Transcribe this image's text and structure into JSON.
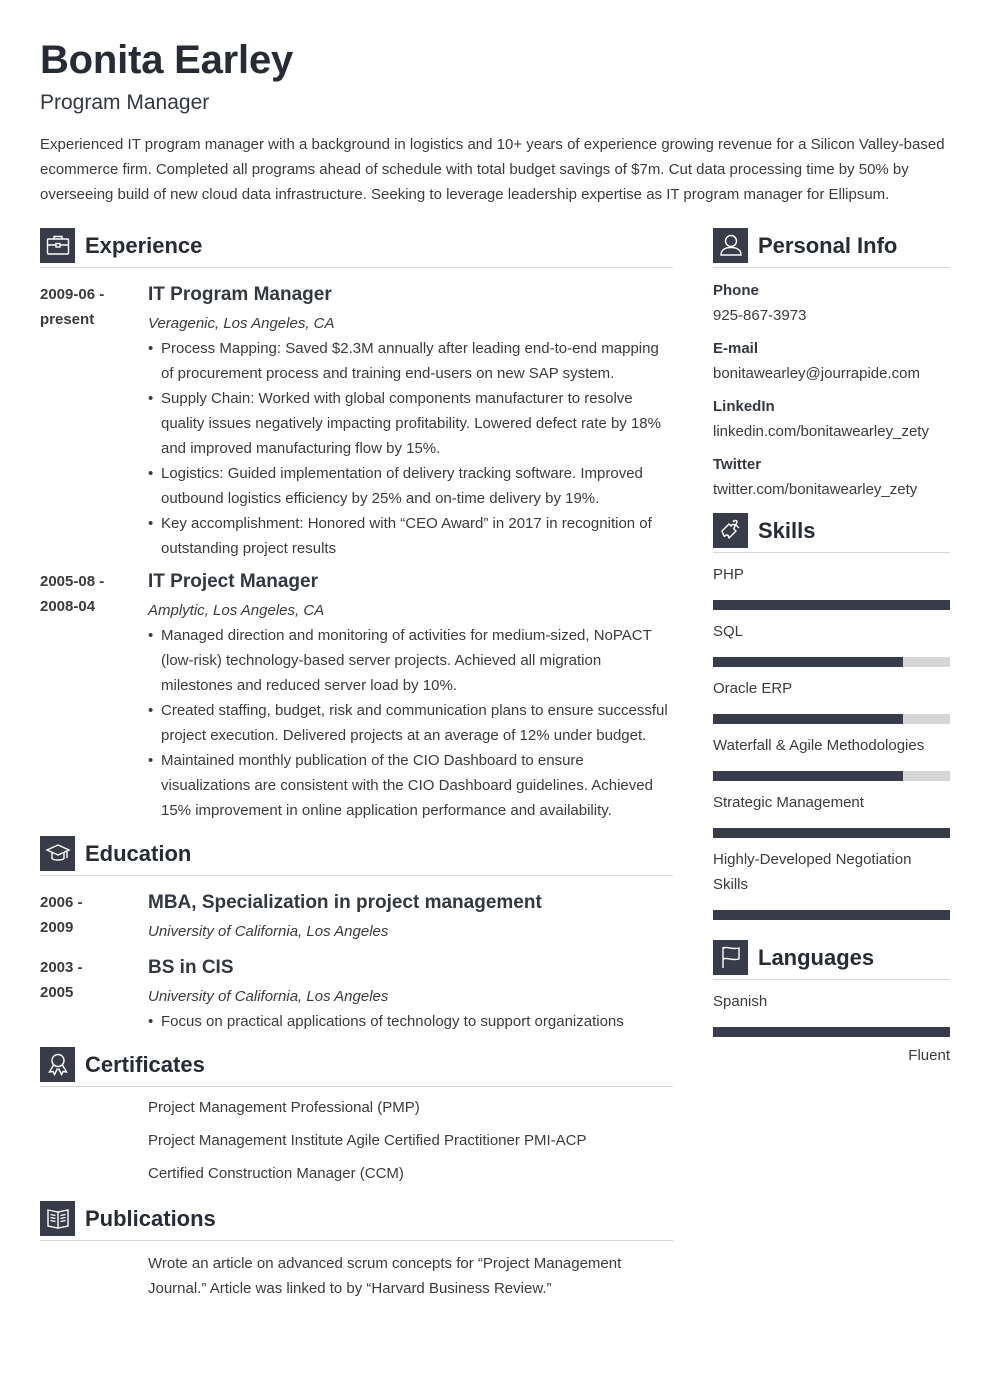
{
  "header": {
    "name": "Bonita Earley",
    "title": "Program Manager",
    "summary": "Experienced IT program manager with a background in logistics and 10+ years of experience growing revenue for a Silicon Valley-based ecommerce firm. Completed all programs ahead of schedule with total budget savings of $7m. Cut data processing time by 50% by overseeing build of new cloud data infrastructure. Seeking to leverage leadership expertise as IT program manager for Ellipsum."
  },
  "experience": {
    "heading": "Experience",
    "icon": "briefcase-icon",
    "entries": [
      {
        "date_start": "2009-06 -",
        "date_end": "present",
        "title": "IT Program Manager",
        "company": "Veragenic, Los Angeles, CA",
        "bullets": [
          "Process Mapping: Saved $2.3M annually after leading end-to-end mapping of procurement process and training end-users on new SAP system.",
          "Supply Chain: Worked with global components manufacturer to resolve quality issues negatively impacting profitability. Lowered defect rate by 18% and improved manufacturing flow by 15%.",
          "Logistics: Guided implementation of delivery tracking software. Improved outbound logistics efficiency by 25% and on-time delivery by 19%.",
          "Key accomplishment: Honored with “CEO Award” in 2017 in recognition of outstanding project results"
        ]
      },
      {
        "date_start": "2005-08 -",
        "date_end": "2008-04",
        "title": "IT Project Manager",
        "company": "Amplytic, Los Angeles, CA",
        "bullets": [
          "Managed direction and monitoring of activities for medium-sized, NoPACT (low-risk) technology-based server projects. Achieved all migration milestones and reduced server load by 10%.",
          "Created staffing, budget, risk and communication plans to ensure successful project execution. Delivered projects at an average of 12% under budget.",
          "Maintained monthly publication of the CIO Dashboard to ensure visualizations are consistent with the CIO Dashboard guidelines. Achieved 15% improvement in online application performance and availability."
        ]
      }
    ]
  },
  "education": {
    "heading": "Education",
    "icon": "graduation-cap-icon",
    "entries": [
      {
        "date_start": "2006 -",
        "date_end": "2009",
        "title": "MBA, Specialization in project management",
        "school": "University of California, Los Angeles",
        "bullets": []
      },
      {
        "date_start": "2003 -",
        "date_end": "2005",
        "title": "BS in CIS",
        "school": "University of California, Los Angeles",
        "bullets": [
          "Focus on practical applications of technology to support organizations"
        ]
      }
    ]
  },
  "certificates": {
    "heading": "Certificates",
    "icon": "award-ribbon-icon",
    "items": [
      "Project Management Professional (PMP)",
      "Project Management Institute Agile Certified Practitioner PMI-ACP",
      "Certified Construction Manager (CCM)"
    ]
  },
  "publications": {
    "heading": "Publications",
    "icon": "open-book-icon",
    "items": [
      "Wrote an article on advanced scrum concepts for “Project Management Journal.” Article was linked to by “Harvard Business Review.”"
    ]
  },
  "personal_info": {
    "heading": "Personal Info",
    "icon": "user-icon",
    "items": [
      {
        "label": "Phone",
        "value": "925-867-3973"
      },
      {
        "label": "E-mail",
        "value": "bonitawearley@jourrapide.com"
      },
      {
        "label": "LinkedIn",
        "value": "linkedin.com/bonitawearley_zety"
      },
      {
        "label": "Twitter",
        "value": "twitter.com/bonitawearley_zety"
      }
    ]
  },
  "skills": {
    "heading": "Skills",
    "icon": "puzzle-piece-icon",
    "items": [
      {
        "name": "PHP",
        "level": 1.0
      },
      {
        "name": "SQL",
        "level": 0.8
      },
      {
        "name": "Oracle ERP",
        "level": 0.8
      },
      {
        "name": "Waterfall & Agile Methodologies",
        "level": 0.8
      },
      {
        "name": "Strategic Management",
        "level": 1.0
      },
      {
        "name": "Highly-Developed Negotiation Skills",
        "level": 1.0
      }
    ]
  },
  "languages": {
    "heading": "Languages",
    "icon": "flag-icon",
    "items": [
      {
        "name": "Spanish",
        "level": 1.0,
        "level_label": "Fluent"
      }
    ]
  },
  "colors": {
    "accent": "#373c48",
    "bar_track": "#d6d6d6",
    "heading_text": "#272b35",
    "body_text": "#3b3b3b"
  }
}
